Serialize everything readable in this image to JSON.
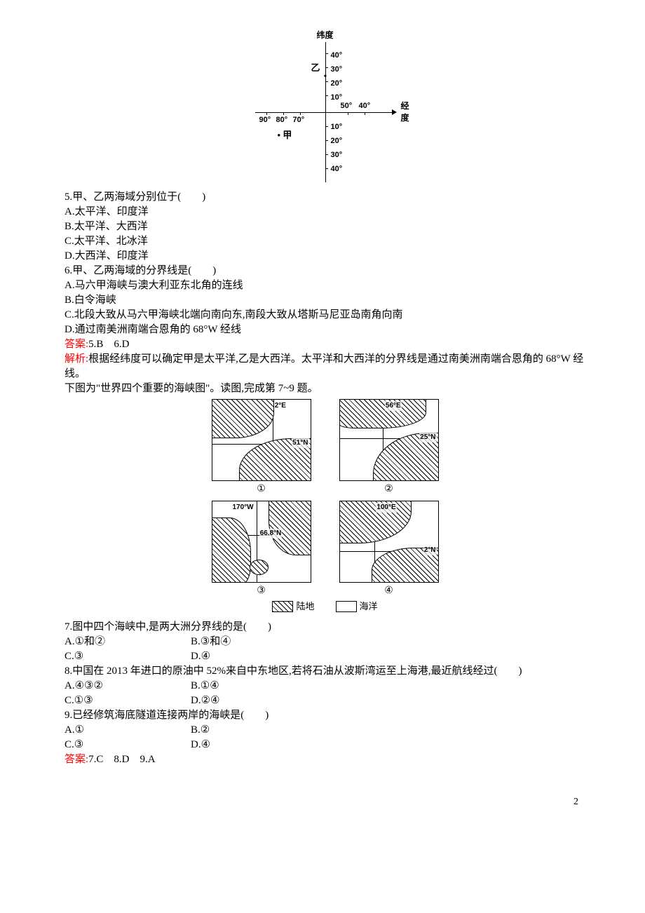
{
  "chart_data": {
    "type": "scatter",
    "title": "",
    "xlabel": "经度",
    "ylabel": "纬度",
    "x_ticks_left": [
      "90°",
      "80°",
      "70°"
    ],
    "x_ticks_right": [
      "50°",
      "40°"
    ],
    "y_ticks_top": [
      "40°",
      "30°",
      "20°",
      "10°"
    ],
    "y_ticks_bottom": [
      "10°",
      "20°",
      "30°",
      "40°"
    ],
    "points": [
      {
        "name": "甲",
        "approx_x": "80°W",
        "approx_y": "15°S"
      },
      {
        "name": "乙",
        "approx_x": "origin",
        "approx_y": "30°N"
      }
    ]
  },
  "graph": {
    "y_axis_label": "纬度",
    "x_axis_label": "经度",
    "y_top": [
      "40°",
      "30°",
      "20°",
      "10°"
    ],
    "y_bottom": [
      "10°",
      "20°",
      "30°",
      "40°"
    ],
    "x_left": [
      "90°",
      "80°",
      "70°"
    ],
    "x_right": [
      "50°",
      "40°"
    ],
    "point_jia": "甲",
    "point_yi": "乙"
  },
  "q5": {
    "stem": "5.甲、乙两海域分别位于(　　)",
    "a": "A.太平洋、印度洋",
    "b": "B.太平洋、大西洋",
    "c": "C.太平洋、北冰洋",
    "d": "D.大西洋、印度洋"
  },
  "q6": {
    "stem": "6.甲、乙两海域的分界线是(　　)",
    "a": "A.马六甲海峡与澳大利亚东北角的连线",
    "b": "B.白令海峡",
    "c": "C.北段大致从马六甲海峡北端向南向东,南段大致从塔斯马尼亚岛南角向南",
    "d": "D.通过南美洲南端合恩角的 68°W 经线"
  },
  "answer56_label": "答案:",
  "answer56_value": "5.B　6.D",
  "analysis56_label": "解析:",
  "analysis56_value": "根据经纬度可以确定甲是太平洋,乙是大西洋。太平洋和大西洋的分界线是通过南美洲南端合恩角的 68°W 经线。",
  "fig_intro": "下图为\"世界四个重要的海峡图\"。读图,完成第 7~9 题。",
  "straits": {
    "s1": {
      "lon": "2°E",
      "lat": "51°N",
      "label": "①"
    },
    "s2": {
      "lon": "56°E",
      "lat": "25°N",
      "label": "②"
    },
    "s3": {
      "lon": "170°W",
      "lat": "66.8°N",
      "label": "③"
    },
    "s4": {
      "lon": "100°E",
      "lat": "2°N",
      "label": "④"
    },
    "legend_land": "陆地",
    "legend_sea": "海洋"
  },
  "q7": {
    "stem": "7.图中四个海峡中,是两大洲分界线的是(　　)",
    "a": "A.①和②",
    "b": "B.③和④",
    "c": "C.③",
    "d": "D.④"
  },
  "q8": {
    "stem": "8.中国在 2013 年进口的原油中 52%来自中东地区,若将石油从波斯湾运至上海港,最近航线经过(　　)",
    "a": "A.④③②",
    "b": "B.①④",
    "c": "C.①③",
    "d": "D.②④"
  },
  "q9": {
    "stem": "9.已经修筑海底隧道连接两岸的海峡是(　　)",
    "a": "A.①",
    "b": "B.②",
    "c": "C.③",
    "d": "D.④"
  },
  "answer789_label": "答案:",
  "answer789_value": "7.C　8.D　9.A",
  "page_number": "2"
}
